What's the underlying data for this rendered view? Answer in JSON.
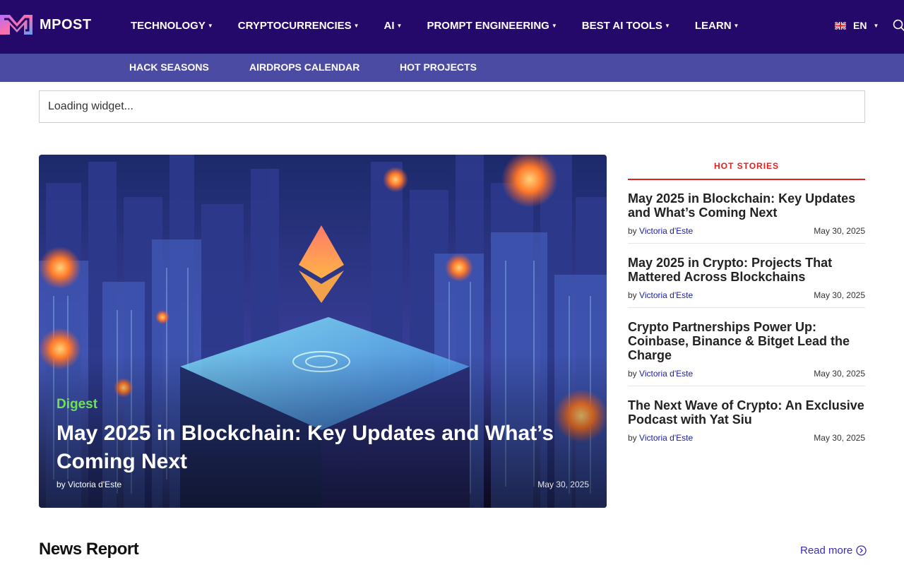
{
  "brand": {
    "name": "MPOST"
  },
  "nav": {
    "items": [
      {
        "label": "TECHNOLOGY"
      },
      {
        "label": "CRYPTOCURRENCIES"
      },
      {
        "label": "AI"
      },
      {
        "label": "PROMPT ENGINEERING"
      },
      {
        "label": "BEST AI TOOLS"
      },
      {
        "label": "LEARN"
      }
    ],
    "language": "EN",
    "language_flag_icon": "uk-flag-icon",
    "search_icon": "search-icon"
  },
  "subnav": {
    "items": [
      {
        "label": "HACK SEASONS"
      },
      {
        "label": "AIRDROPS CALENDAR"
      },
      {
        "label": "HOT PROJECTS"
      }
    ]
  },
  "widget": {
    "text": "Loading widget..."
  },
  "hero": {
    "category": "Digest",
    "title": "May 2025 in Blockchain: Key Updates and What’s Coming Next",
    "by": "by",
    "author": "Victoria d'Este",
    "date": "May 30, 2025"
  },
  "hot_stories": {
    "heading": "HOT STORIES",
    "items": [
      {
        "title": "May 2025 in Blockchain: Key Updates and What’s Coming Next",
        "by": "by",
        "author": "Victoria d'Este",
        "date": "May 30, 2025"
      },
      {
        "title": "May 2025 in Crypto: Projects That Mattered Across Blockchains",
        "by": "by",
        "author": "Victoria d'Este",
        "date": "May 30, 2025"
      },
      {
        "title": "Crypto Partnerships Power Up: Coinbase, Binance & Bitget Lead the Charge",
        "by": "by",
        "author": "Victoria d'Este",
        "date": "May 30, 2025"
      },
      {
        "title": "The Next Wave of Crypto: An Exclusive Podcast with Yat Siu",
        "by": "by",
        "author": "Victoria d'Este",
        "date": "May 30, 2025"
      }
    ]
  },
  "news_report": {
    "heading": "News Report",
    "read_more": "Read more"
  },
  "colors": {
    "topbar": "#24096b",
    "subbar": "#4b4ba3",
    "hot_accent": "#e0201f",
    "category_green": "#6fe05a",
    "link": "#3a2bbd"
  }
}
